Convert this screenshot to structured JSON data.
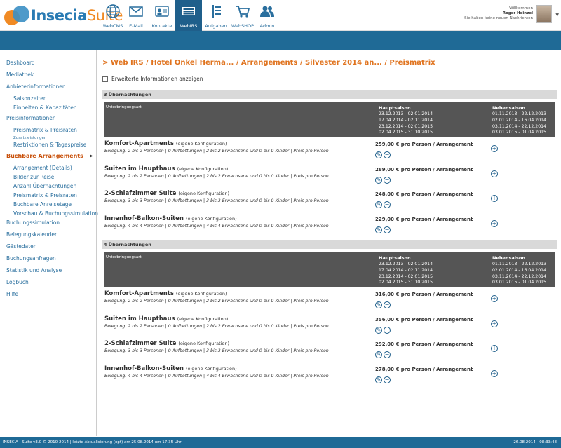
{
  "app": {
    "brand_part1": "Insecia",
    "brand_part2": "Suite"
  },
  "nav": [
    {
      "label": "WebCMS",
      "icon": "globe-icon"
    },
    {
      "label": "E-Mail",
      "icon": "envelope-icon"
    },
    {
      "label": "Kontakte",
      "icon": "contact-card-icon"
    },
    {
      "label": "WebIRS",
      "icon": "rooms-available-icon",
      "active": true
    },
    {
      "label": "Aufgaben",
      "icon": "tasks-icon"
    },
    {
      "label": "WebSHOP",
      "icon": "cart-icon"
    },
    {
      "label": "Admin",
      "icon": "users-icon"
    }
  ],
  "user": {
    "greeting": "Willkommen",
    "name": "Roger Heinzel",
    "messages": "Sie haben keine neuen Nachrichten"
  },
  "sidebar": {
    "dashboard": "Dashboard",
    "mediathek": "Mediathek",
    "anbieter": "Anbieterinformationen",
    "saisonzeiten": "Saisonzeiten",
    "einheiten": "Einheiten & Kapazitäten",
    "preisinfo": "Preisinformationen",
    "preismatrix": "Preismatrix & Preisraten",
    "zusatzleistungen": "Zusatzleistungen",
    "restriktionen": "Restriktionen & Tagespreise",
    "buchbare": "Buchbare Arrangements",
    "arrangement": "Arrangement (Details)",
    "bilder": "Bilder zur Reise",
    "anzahl": "Anzahl Übernachtungen",
    "preismatrix2": "Preismatrix & Preisraten",
    "anreisetage": "Buchbare Anreisetage",
    "vorschau": "Vorschau & Buchungssimulation",
    "buchungssim": "Buchungssimulation",
    "belegungskalender": "Belegungskalender",
    "gaestedaten": "Gästedaten",
    "buchungsanfragen": "Buchungsanfragen",
    "statistik": "Statistik und Analyse",
    "logbuch": "Logbuch",
    "hilfe": "Hilfe",
    "arrow": "▶"
  },
  "main": {
    "breadcrumb": "> Web IRS / Hotel Onkel Herma... / Arrangements / Silvester 2014 an... / Preismatrix",
    "ext_info": "Erweiterte Informationen anzeigen"
  },
  "table_header": {
    "unterbringungsart": "Unterbringungsart",
    "haupt": "Hauptsaison",
    "neben": "Nebensaison",
    "haupt_dates": [
      "23.12.2013 - 02.01.2014",
      "17.04.2014 - 02.11.2014",
      "23.12.2014 - 02.01.2015",
      "02.04.2015 - 31.10.2015"
    ],
    "neben_dates": [
      "01.11.2013 - 22.12.2013",
      "02.01.2014 - 16.04.2014",
      "03.11.2014 - 22.12.2014",
      "03.01.2015 - 01.04.2015"
    ]
  },
  "conf_label": "(eigene Konfiguration)",
  "sections": [
    {
      "title": "3 Übernachtungen",
      "rows": [
        {
          "name": "Komfort-Apartments",
          "belegung": "Belegung: 2 bis 2 Personen  | 0 Aufbettungen  | 2 bis 2 Erwachsene und 0 bis 0 Kinder  | Preis pro Person",
          "price": "259,00 € pro Person / Arrangement"
        },
        {
          "name": "Suiten im Haupthaus",
          "belegung": "Belegung: 2 bis 2 Personen  | 0 Aufbettungen  | 2 bis 2 Erwachsene und 0 bis 0 Kinder  | Preis pro Person",
          "price": "289,00 € pro Person / Arrangement"
        },
        {
          "name": "2-Schlafzimmer Suite",
          "belegung": "Belegung: 3 bis 3 Personen  | 0 Aufbettungen  | 3 bis 3 Erwachsene und 0 bis 0 Kinder  | Preis pro Person",
          "price": "248,00 € pro Person / Arrangement"
        },
        {
          "name": "Innenhof-Balkon-Suiten",
          "belegung": "Belegung: 4 bis 4 Personen  | 0 Aufbettungen  | 4 bis 4 Erwachsene und 0 bis 0 Kinder  | Preis pro Person",
          "price": "229,00 € pro Person / Arrangement"
        }
      ]
    },
    {
      "title": "4 Übernachtungen",
      "rows": [
        {
          "name": "Komfort-Apartments",
          "belegung": "Belegung: 2 bis 2 Personen  | 0 Aufbettungen  | 2 bis 2 Erwachsene und 0 bis 0 Kinder  | Preis pro Person",
          "price": "316,00 € pro Person / Arrangement"
        },
        {
          "name": "Suiten im Haupthaus",
          "belegung": "Belegung: 2 bis 2 Personen  | 0 Aufbettungen  | 2 bis 2 Erwachsene und 0 bis 0 Kinder  | Preis pro Person",
          "price": "356,00 € pro Person / Arrangement"
        },
        {
          "name": "2-Schlafzimmer Suite",
          "belegung": "Belegung: 3 bis 3 Personen  | 0 Aufbettungen  | 3 bis 3 Erwachsene und 0 bis 0 Kinder  | Preis pro Person",
          "price": "292,00 € pro Person / Arrangement"
        },
        {
          "name": "Innenhof-Balkon-Suiten",
          "belegung": "Belegung: 4 bis 4 Personen  | 0 Aufbettungen  | 4 bis 4 Erwachsene und 0 bis 0 Kinder  | Preis pro Person",
          "price": "278,00 € pro Person / Arrangement"
        }
      ]
    }
  ],
  "footer": {
    "left": "INSECIA | Suite v3.0 © 2010-2014 | letzte Aktualisierung (opt) am 25.08.2014 um 17:35 Uhr",
    "right": "26.08.2014 - 08:33:48"
  }
}
